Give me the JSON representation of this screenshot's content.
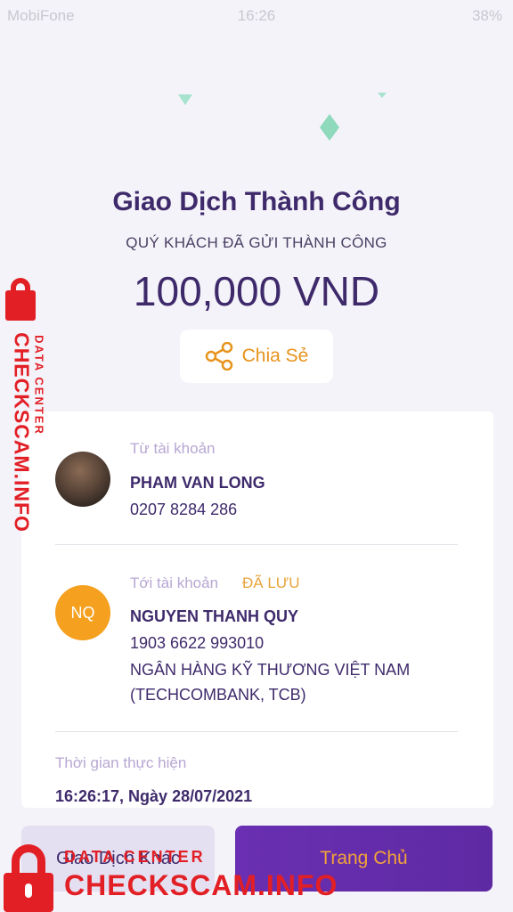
{
  "status_bar": {
    "carrier": "MobiFone",
    "time": "16:26",
    "battery": "38%"
  },
  "result": {
    "title": "Giao Dịch Thành Công",
    "subtitle": "QUÝ KHÁCH ĐÃ GỬI THÀNH CÔNG",
    "amount": "100,000 VND",
    "share_label": "Chia Sẻ"
  },
  "from": {
    "label": "Từ tài khoản",
    "name": "PHAM VAN LONG",
    "account": "0207 8284 286"
  },
  "to": {
    "label": "Tới tài khoản",
    "saved_badge": "ĐÃ LƯU",
    "initials": "NQ",
    "name": "NGUYEN THANH QUY",
    "account": "1903 6622 993010",
    "bank_line1": "NGÂN HÀNG KỸ THƯƠNG VIỆT NAM",
    "bank_line2": "(TECHCOMBANK, TCB)"
  },
  "time": {
    "label": "Thời gian thực hiện",
    "value": "16:26:17, Ngày 28/07/2021"
  },
  "actions": {
    "other_label": "Giao Dịch Khác",
    "home_label": "Trang Chủ"
  },
  "watermark": {
    "data_center": "DATA CENTER",
    "brand": "CHECKSCAM.INFO"
  },
  "colors": {
    "primary": "#3e2a6b",
    "accent": "#e7931c",
    "button_purple": "#6a2fb2",
    "watermark_red": "#e21f25"
  },
  "icons": [
    "wifi-icon",
    "share-icon",
    "location-icon",
    "battery-icon"
  ]
}
